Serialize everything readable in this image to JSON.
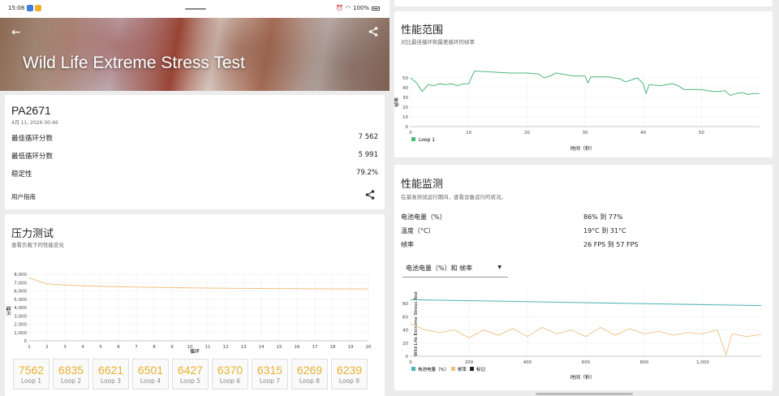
{
  "status": {
    "time": "15:08",
    "battery": "100%"
  },
  "hero": {
    "title": "Wild Life Extreme Stress Test"
  },
  "result": {
    "device": "PA2671",
    "date": "4月 11, 2026 00:46",
    "rows": [
      {
        "label": "最佳循环分数",
        "value": "7 562"
      },
      {
        "label": "最低循环分数",
        "value": "5 991"
      },
      {
        "label": "稳定性",
        "value": "79.2%"
      }
    ],
    "guide": "用户指南"
  },
  "stress": {
    "title": "压力测试",
    "subtitle": "查看负载下的性能变化",
    "y_label": "分数",
    "x_label": "循环",
    "loops": [
      {
        "value": "7562",
        "label": "Loop 1"
      },
      {
        "value": "6835",
        "label": "Loop 2"
      },
      {
        "value": "6621",
        "label": "Loop 3"
      },
      {
        "value": "6501",
        "label": "Loop 4"
      },
      {
        "value": "6427",
        "label": "Loop 5"
      },
      {
        "value": "6370",
        "label": "Loop 6"
      },
      {
        "value": "6315",
        "label": "Loop 7"
      },
      {
        "value": "6269",
        "label": "Loop 8"
      },
      {
        "value": "6239",
        "label": "Loop 9"
      }
    ]
  },
  "range": {
    "title": "性能范围",
    "subtitle": "对比最佳循环和最差循环的帧率",
    "y_label": "帧率",
    "x_label": "时间（秒）",
    "legend": "Loop 1"
  },
  "monitor": {
    "title": "性能监测",
    "subtitle": "在基准测试运行期间，查看设备运行的状况。",
    "rows": [
      {
        "label": "电池电量（%）",
        "value": "86% 到 77%"
      },
      {
        "label": "温度（°C）",
        "value": "19°C 到 31°C"
      },
      {
        "label": "帧率",
        "value": "26 FPS 到 57 FPS"
      }
    ],
    "select_value": "电池电量（%）和 帧率",
    "y_label": "Wild Life Extreme Stress Test",
    "x_label": "时间（秒）",
    "legend": [
      "电池电量（%）",
      "帧率",
      "标记"
    ]
  },
  "chart_data": [
    {
      "type": "line",
      "x": [
        1,
        2,
        3,
        4,
        5,
        6,
        7,
        8,
        9,
        10,
        11,
        12,
        13,
        14,
        15,
        16,
        17,
        18,
        19,
        20
      ],
      "series": [
        {
          "values": [
            7562,
            6835,
            6720,
            6621,
            6560,
            6501,
            6460,
            6427,
            6400,
            6370,
            6345,
            6315,
            6300,
            6290,
            6280,
            6269,
            6255,
            6245,
            6239,
            6235
          ]
        }
      ],
      "ylim": [
        0,
        8000
      ],
      "yticks": [
        "0",
        "1,000",
        "2,000",
        "3,000",
        "4,000",
        "5,000",
        "6,000",
        "7,000",
        "8,000"
      ],
      "xlabel": "循环",
      "ylabel": "分数",
      "colors": {
        "line": "#f0c080"
      }
    },
    {
      "type": "line",
      "x": [
        0,
        1,
        2,
        3,
        4,
        5,
        6,
        7,
        8,
        9,
        10,
        10.5,
        11,
        14,
        17,
        20,
        22,
        23,
        24,
        25,
        26,
        28,
        30,
        30.5,
        31,
        34,
        36,
        37,
        39,
        40,
        40.5,
        41,
        43,
        44,
        45,
        46,
        47,
        50,
        52,
        53,
        54,
        55,
        56,
        57,
        58,
        59,
        60
      ],
      "series": [
        {
          "name": "Loop 1",
          "values": [
            50,
            45,
            36,
            43,
            42,
            44,
            43,
            44,
            42,
            44,
            44,
            51,
            57,
            56,
            55,
            55,
            54,
            50,
            52,
            55,
            54,
            52,
            52,
            45,
            51,
            51,
            49,
            46,
            50,
            44,
            34,
            43,
            42,
            43,
            44,
            42,
            38,
            38,
            36,
            36,
            37,
            32,
            34,
            35,
            33,
            34,
            34
          ]
        }
      ],
      "ylim": [
        0,
        60
      ],
      "xticks": [
        0,
        10,
        20,
        30,
        40,
        50
      ],
      "yticks": [
        0,
        10,
        20,
        30,
        40,
        50
      ],
      "xlabel": "时间（秒）",
      "ylabel": "帧率",
      "colors": {
        "line": "#4cb87a"
      }
    },
    {
      "type": "line",
      "xlim": [
        0,
        1200
      ],
      "xticks": [
        "0",
        "200",
        "400",
        "600",
        "800",
        "1,000"
      ],
      "ylim": [
        0,
        100
      ],
      "yticks": [
        0,
        20,
        40,
        60,
        80
      ],
      "xlabel": "时间（秒）",
      "series": [
        {
          "name": "电池电量（%）",
          "x": [
            0,
            1200
          ],
          "values": [
            86,
            77
          ]
        },
        {
          "name": "帧率",
          "x": [
            0,
            50,
            100,
            150,
            200,
            250,
            300,
            350,
            400,
            450,
            500,
            550,
            600,
            650,
            700,
            750,
            800,
            850,
            900,
            950,
            1000,
            1050,
            1080,
            1100,
            1150,
            1200
          ],
          "values": [
            50,
            40,
            36,
            40,
            28,
            40,
            32,
            42,
            30,
            44,
            34,
            40,
            30,
            44,
            32,
            42,
            34,
            38,
            32,
            36,
            34,
            40,
            2,
            34,
            30,
            33
          ]
        }
      ],
      "colors": {
        "battery": "#4bb3b3",
        "fps": "#f0c080"
      }
    }
  ]
}
